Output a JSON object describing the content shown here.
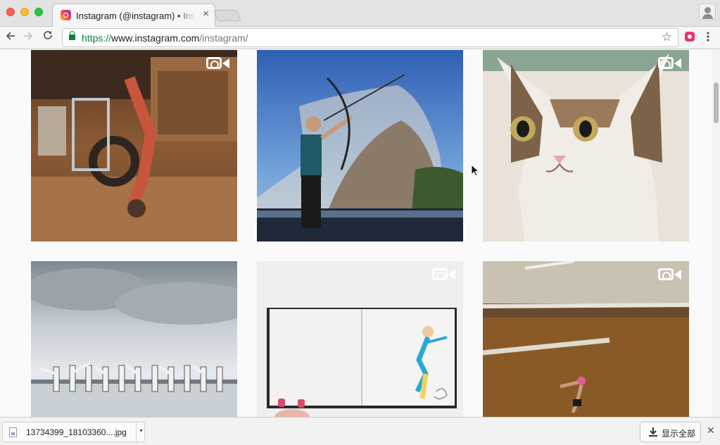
{
  "browser": {
    "tab": {
      "title": "Instagram (@instagram) • Instagram photos and videos",
      "close_icon": "×"
    },
    "address_bar": {
      "scheme": "https://",
      "host": "www.instagram.com",
      "path": "/instagram/"
    }
  },
  "feed": {
    "posts": [
      {
        "subject": "child upside-down on tire swing",
        "is_video": true
      },
      {
        "subject": "archer in front of mountain",
        "is_video": false
      },
      {
        "subject": "cat close-up",
        "is_video": true
      },
      {
        "subject": "martial artists kicking on beach",
        "is_video": false
      },
      {
        "subject": "sketchbook animation",
        "is_video": true
      },
      {
        "subject": "gymnast on beams",
        "is_video": true
      }
    ]
  },
  "downloads": {
    "file_name": "13734399_18103360....jpg",
    "show_all_label": "显示全部"
  },
  "icons": {
    "back": "back-arrow-icon",
    "forward": "forward-arrow-icon",
    "reload": "reload-icon",
    "bookmark": "star-icon",
    "menu": "kebab-menu-icon"
  }
}
